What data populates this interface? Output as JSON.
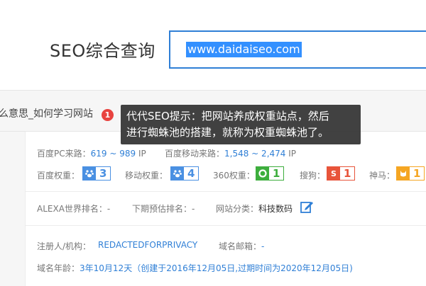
{
  "header": {
    "title": "SEO综合查询",
    "search_value": "www.daidaiseo.com"
  },
  "site_bar": {
    "title_text": "么意思_如何学习网站",
    "badge": "1",
    "tooltip_line1": "代代SEO提示：把网站养成权重站点，然后",
    "tooltip_line2": "进行蜘蛛池的搭建，就称为权重蜘蛛池了。"
  },
  "traffic": {
    "pc_label": "百度PC来路：",
    "pc_value": "619 ~ 989",
    "pc_unit": " IP",
    "mobile_label": "百度移动来路：",
    "mobile_value": "1,548 ~ 2,474",
    "mobile_unit": " IP"
  },
  "weights": [
    {
      "label": "百度权重：",
      "value": "3",
      "color": "#4a90e2",
      "icon": "paw-icon"
    },
    {
      "label": "移动权重：",
      "value": "4",
      "color": "#4a90e2",
      "icon": "paw-icon"
    },
    {
      "label": "360权重：",
      "value": "1",
      "color": "#3dae3d",
      "icon": "360-icon"
    },
    {
      "label": "搜狗：",
      "value": "1",
      "color": "#e8543a",
      "icon": "sogou-icon"
    },
    {
      "label": "神马：",
      "value": "1",
      "color": "#f5a623",
      "icon": "shenma-icon"
    }
  ],
  "rank": {
    "alexa_label": "ALEXA世界排名：",
    "alexa_value": "-",
    "forecast_label": "下期预估排名：",
    "forecast_value": "-",
    "category_label": "网站分类：",
    "category_value": "科技数码"
  },
  "whois": {
    "registrant_label": "注册人/机构：",
    "registrant_value": "REDACTEDFORPRIVACY",
    "email_label": "域名邮箱：",
    "email_value": "-",
    "age_label": "域名年龄：",
    "age_value": "3年10月12天（创建于2016年12月05日,过期时间为2020年12月05日)"
  }
}
